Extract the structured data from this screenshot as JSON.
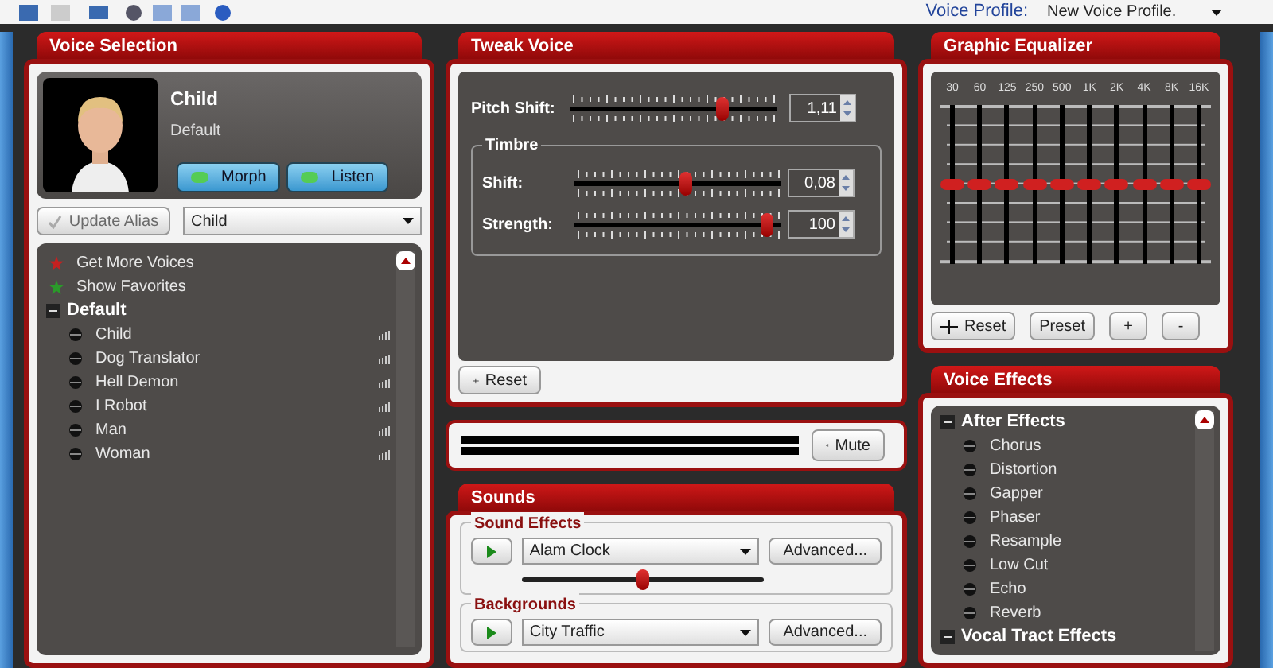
{
  "toolbar": {
    "profile_label": "Voice Profile:",
    "profile_value": "New Voice Profile."
  },
  "voice_selection": {
    "title": "Voice Selection",
    "voice_name": "Child",
    "voice_category": "Default",
    "buttons": [
      "Morph",
      "Listen"
    ],
    "update_alias": {
      "label": "Update Alias",
      "disabled": true
    },
    "voice_dropdown": "Child",
    "actions": [
      {
        "label": "Get More Voices",
        "color": "#c62020"
      },
      {
        "label": "Show Favorites",
        "color": "#2a9a2a"
      }
    ],
    "groups": [
      {
        "label": "Default",
        "expanded": true,
        "children": [
          {
            "label": "Child"
          },
          {
            "label": "Dog Translator"
          },
          {
            "label": "Hell Demon"
          },
          {
            "label": "I Robot"
          },
          {
            "label": "Man"
          },
          {
            "label": "Woman"
          }
        ]
      }
    ]
  },
  "tweak_voice": {
    "title": "Tweak Voice",
    "pitch": {
      "label": "Pitch Shift:",
      "level": 0.76,
      "value": "1,11"
    },
    "timbre_title": "Timbre",
    "timbre": [
      {
        "label": "Shift:",
        "level": 0.54,
        "value": "0,08"
      },
      {
        "label": "Strength:",
        "level": 0.97,
        "value": "100"
      }
    ],
    "reset": "Reset"
  },
  "mute": {
    "label": "Mute"
  },
  "sounds": {
    "title": "Sounds",
    "groups": [
      {
        "title": "Sound Effects",
        "value": "Alam Clock",
        "advanced": "Advanced...",
        "volume": {
          "level": 0.5
        }
      },
      {
        "title": "Backgrounds",
        "value": "City Traffic",
        "advanced": "Advanced..."
      }
    ]
  },
  "equalizer": {
    "title": "Graphic Equalizer",
    "bands": [
      {
        "label": "30",
        "level": 0.5
      },
      {
        "label": "60",
        "level": 0.5
      },
      {
        "label": "125",
        "level": 0.5
      },
      {
        "label": "250",
        "level": 0.5
      },
      {
        "label": "500",
        "level": 0.5
      },
      {
        "label": "1K",
        "level": 0.5
      },
      {
        "label": "2K",
        "level": 0.5
      },
      {
        "label": "4K",
        "level": 0.5
      },
      {
        "label": "8K",
        "level": 0.5
      },
      {
        "label": "16K",
        "level": 0.5
      }
    ],
    "buttons": [
      "Reset",
      "Preset",
      "+",
      "-"
    ]
  },
  "voice_effects": {
    "title": "Voice Effects",
    "groups": [
      {
        "label": "After Effects",
        "expanded": true,
        "children": [
          {
            "label": "Chorus"
          },
          {
            "label": "Distortion"
          },
          {
            "label": "Gapper"
          },
          {
            "label": "Phaser"
          },
          {
            "label": "Resample"
          },
          {
            "label": "Low Cut"
          },
          {
            "label": "Echo"
          },
          {
            "label": "Reverb"
          }
        ]
      },
      {
        "label": "Vocal Tract Effects",
        "expanded": true
      }
    ]
  }
}
